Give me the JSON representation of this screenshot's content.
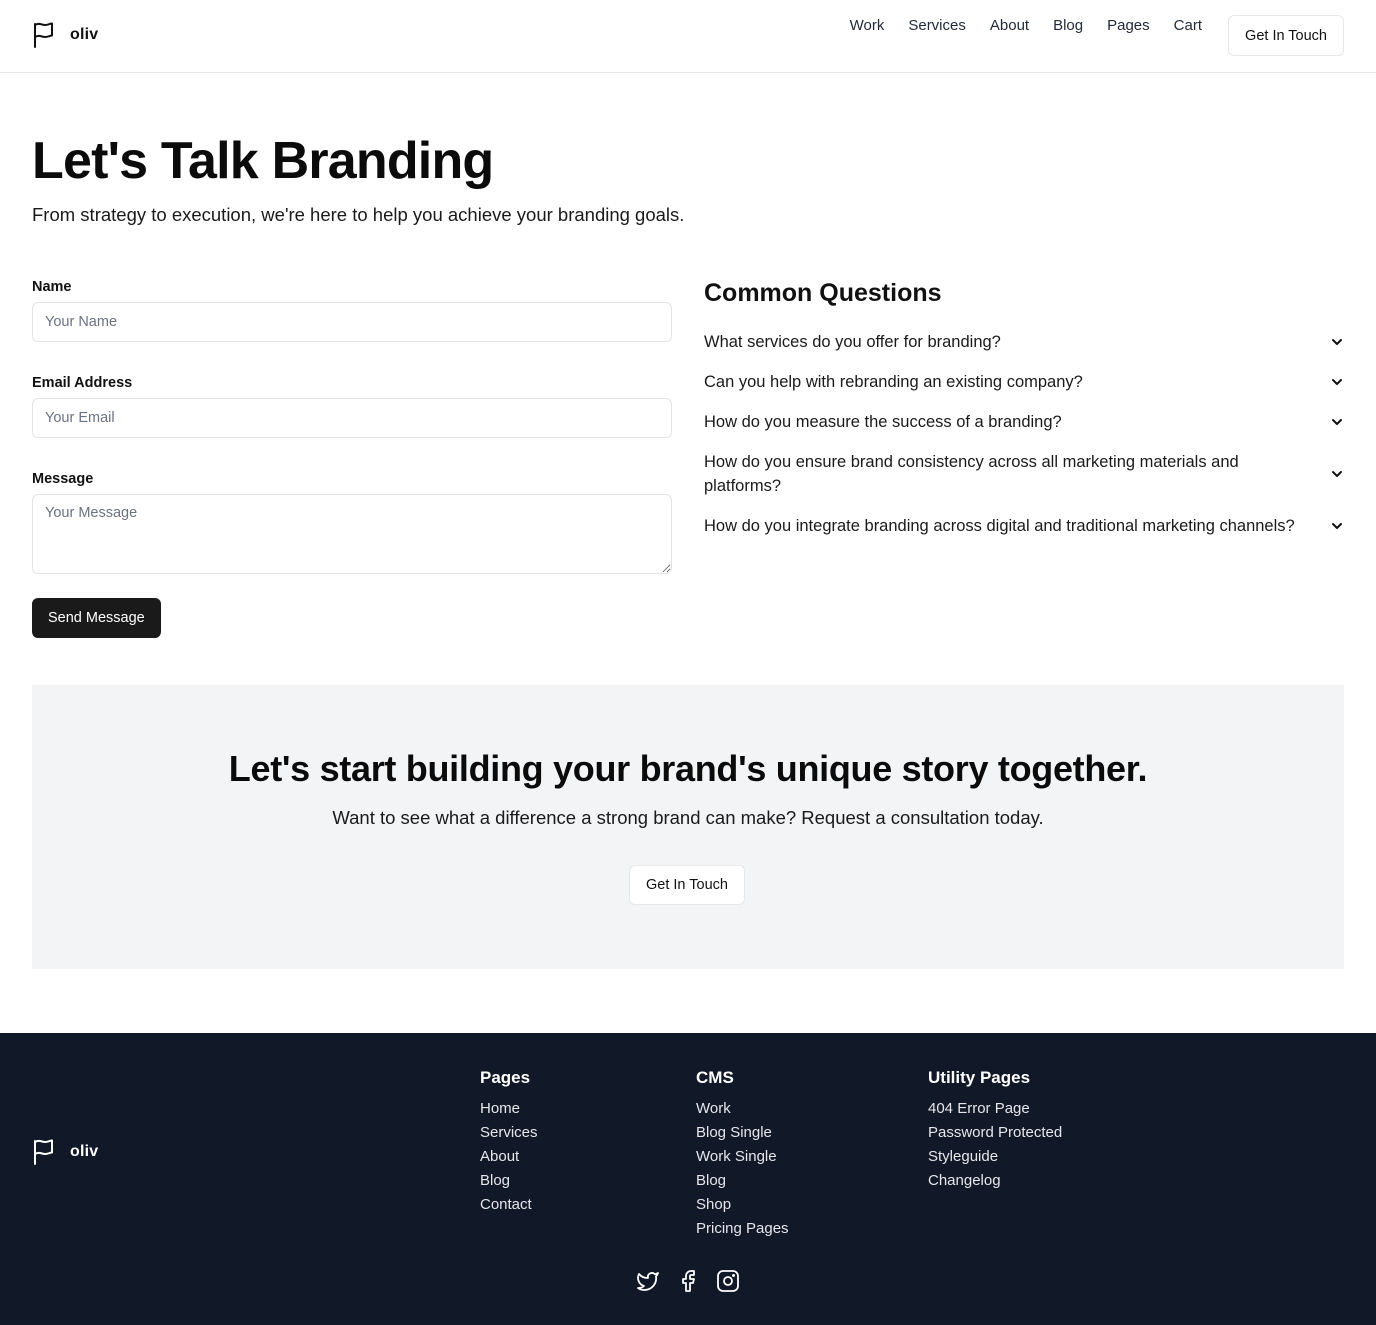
{
  "header": {
    "brand": "oliv",
    "nav": [
      "Work",
      "Services",
      "About",
      "Blog",
      "Pages",
      "Cart"
    ],
    "cta": "Get In Touch"
  },
  "hero": {
    "title": "Let's Talk Branding",
    "subtitle": "From strategy to execution, we're here to help you achieve your branding goals."
  },
  "form": {
    "name_label": "Name",
    "name_placeholder": "Your Name",
    "email_label": "Email Address",
    "email_placeholder": "Your Email",
    "message_label": "Message",
    "message_placeholder": "Your Message",
    "submit": "Send Message"
  },
  "faq": {
    "title": "Common Questions",
    "items": [
      "What services do you offer for branding?",
      "Can you help with rebranding an existing company?",
      "How do you measure the success of a branding?",
      "How do you ensure brand consistency across all marketing materials and platforms?",
      "How do you integrate branding across digital and traditional marketing channels?"
    ]
  },
  "band": {
    "title": "Let's start building your brand's unique story together.",
    "subtitle": "Want to see what a difference a strong brand can make? Request a consultation today.",
    "cta": "Get In Touch"
  },
  "footer": {
    "brand": "oliv",
    "columns": [
      {
        "title": "Pages",
        "links": [
          "Home",
          "Services",
          "About",
          "Blog",
          "Contact"
        ]
      },
      {
        "title": "CMS",
        "links": [
          "Work",
          "Blog Single",
          "Work Single",
          "Blog",
          "Shop",
          "Pricing Pages"
        ]
      },
      {
        "title": "Utility Pages",
        "links": [
          "404 Error Page",
          "Password Protected",
          "Styleguide",
          "Changelog"
        ]
      }
    ],
    "socials": [
      "twitter-icon",
      "facebook-icon",
      "instagram-icon"
    ]
  },
  "colors": {
    "footer_bg": "#111827",
    "band_bg": "#f3f4f6",
    "primary_button": "#1a1a1a"
  }
}
